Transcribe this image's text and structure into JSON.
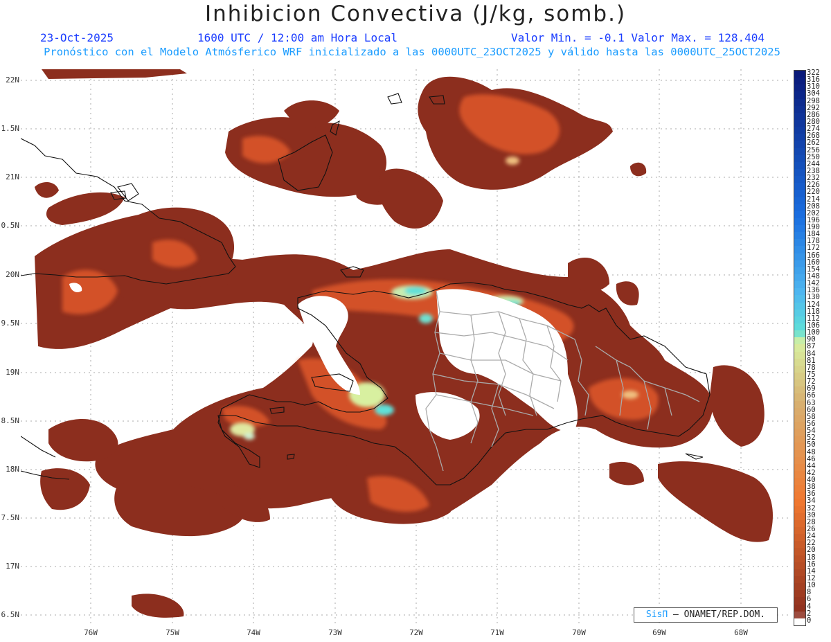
{
  "header": {
    "title": "Inhibicion Convectiva (J/kg, somb.)",
    "date": "23-Oct-2025",
    "time": "1600 UTC / 12:00 am Hora Local",
    "range": "Valor Min. = -0.1  Valor Max. = 128.404",
    "subtitle": "Pronóstico con el Modelo Atmósferico WRF inicializado a las 0000UTC_23OCT2025 y válido hasta las  0000UTC_25OCT2025"
  },
  "axes": {
    "lat_labels": [
      "22N",
      "1.5N",
      "21N",
      "0.5N",
      "20N",
      "9.5N",
      "19N",
      "8.5N",
      "18N",
      "7.5N",
      "17N",
      "6.5N"
    ],
    "lon_labels": [
      "76W",
      "75W",
      "74W",
      "73W",
      "72W",
      "71W",
      "70W",
      "69W",
      "68W"
    ]
  },
  "colorbar": {
    "labels": [
      "322",
      "316",
      "310",
      "304",
      "298",
      "292",
      "286",
      "280",
      "274",
      "268",
      "262",
      "256",
      "250",
      "244",
      "238",
      "232",
      "226",
      "220",
      "214",
      "208",
      "202",
      "196",
      "190",
      "184",
      "178",
      "172",
      "166",
      "160",
      "154",
      "148",
      "142",
      "136",
      "130",
      "124",
      "118",
      "112",
      "106",
      "100",
      "90",
      "87",
      "84",
      "81",
      "78",
      "75",
      "72",
      "69",
      "66",
      "63",
      "60",
      "58",
      "56",
      "54",
      "52",
      "50",
      "48",
      "46",
      "44",
      "42",
      "40",
      "38",
      "36",
      "34",
      "32",
      "30",
      "28",
      "26",
      "24",
      "22",
      "20",
      "18",
      "16",
      "14",
      "12",
      "10",
      "8",
      "6",
      "4",
      "2",
      "0"
    ],
    "colors": {
      "deep_blue": "#0a1a7a",
      "blue": "#1a6ee0",
      "light_blue": "#4fb7f0",
      "cyan": "#5fe0d8",
      "pale_green": "#d8f0a0",
      "tan": "#d8b070",
      "orange": "#f07830",
      "dark_red": "#8c2e1e",
      "zero": "#ffffff"
    }
  },
  "credit": {
    "brand": "SisΠ",
    "org": " – ONAMET/REP.DOM."
  }
}
